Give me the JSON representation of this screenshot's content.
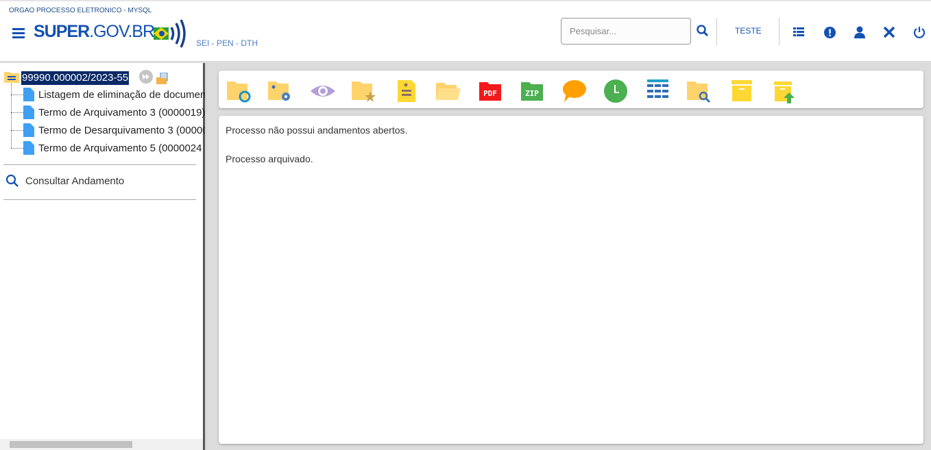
{
  "header": {
    "org": "ORGAO PROCESSO ELETRONICO - MYSQL",
    "logo_bold": "SUPER",
    "logo_rest": ".GOV.BR",
    "subtitle": "SEI - PEN - DTH",
    "search_placeholder": "Pesquisar...",
    "user": "TESTE",
    "icons": [
      "menu-icon",
      "search-icon",
      "list-icon",
      "alert-icon",
      "user-icon",
      "tools-icon",
      "power-icon"
    ]
  },
  "tree": {
    "process": "99990.000002/2023-55",
    "documents": [
      "Listagem de eliminação de documen",
      "Termo de Arquivamento 3 (0000019)",
      "Termo de Desarquivamento 3 (00000",
      "Termo de Arquivamento 5 (0000024"
    ],
    "consult": "Consultar Andamento"
  },
  "toolbar": {
    "icons": [
      "folder-sync-icon",
      "folder-users-settings-icon",
      "eye-icon",
      "folder-star-icon",
      "note-icon",
      "open-folder-icon",
      "pdf-icon",
      "zip-icon",
      "comment-icon",
      "clock-icon",
      "list-icon",
      "folder-search-icon",
      "archive-icon",
      "unarchive-icon"
    ]
  },
  "content": {
    "line1": "Processo não possui andamentos abertos.",
    "line2": "Processo arquivado."
  },
  "colors": {
    "brand": "#1351b4",
    "selection": "#0a2966",
    "folder": "#ffd36b"
  }
}
